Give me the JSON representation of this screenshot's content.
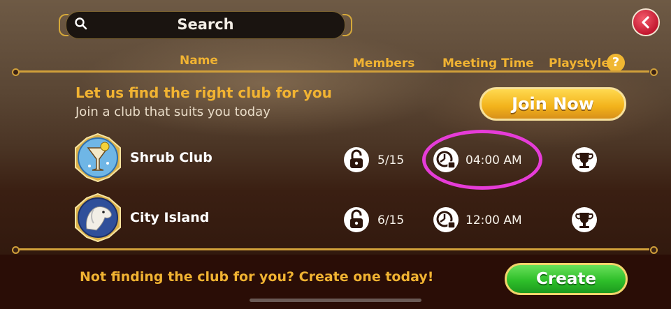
{
  "search": {
    "label": "Search"
  },
  "columns": {
    "name": "Name",
    "members": "Members",
    "meeting_time": "Meeting Time",
    "playstyle": "Playstyle",
    "help": "?"
  },
  "promo": {
    "title": "Let us find the right club for you",
    "subtitle": "Join a club that suits you today",
    "join_label": "Join Now"
  },
  "clubs": [
    {
      "name": "Shrub Club",
      "members": "5/15",
      "meeting_time": "04:00 AM",
      "avatar_icon": "cocktail-icon",
      "playstyle_icon": "trophy-icon"
    },
    {
      "name": "City Island",
      "members": "6/15",
      "meeting_time": "12:00 AM",
      "avatar_icon": "dog-icon",
      "playstyle_icon": "trophy-icon"
    }
  ],
  "footer": {
    "prompt": "Not finding the club for you? Create one today!",
    "create_label": "Create"
  },
  "colors": {
    "gold": "#f1b332",
    "highlight": "#e63cd8",
    "create_green": "#2fbf2a",
    "back_red": "#c21830"
  }
}
